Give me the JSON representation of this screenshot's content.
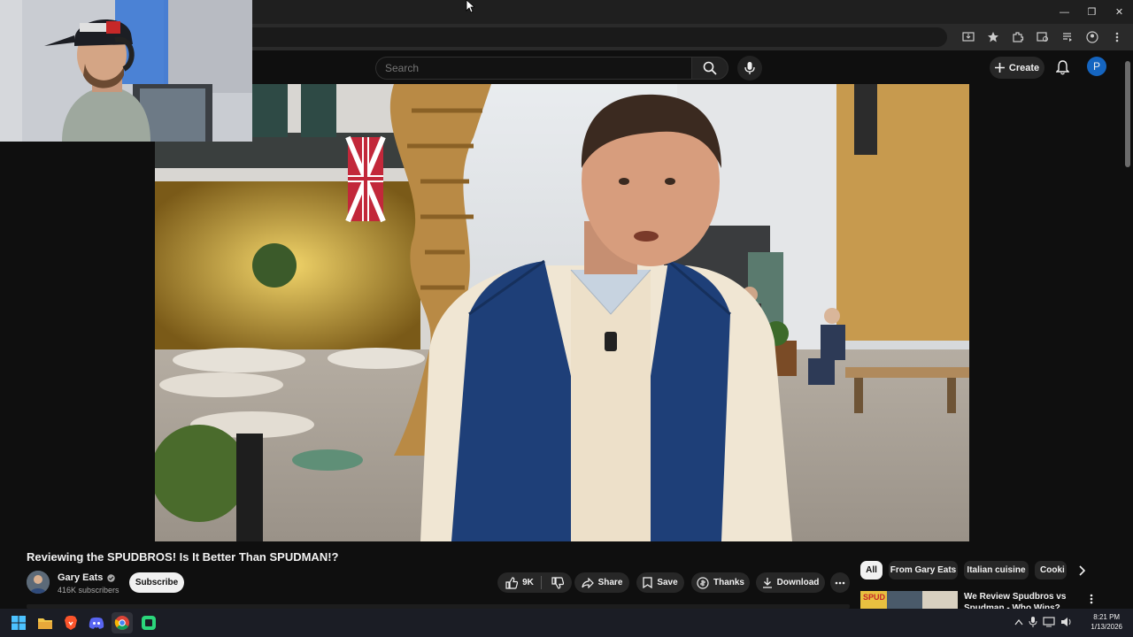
{
  "browser": {
    "window_controls": {
      "minimize": "—",
      "restore": "❐",
      "close": "✕"
    }
  },
  "header": {
    "search_placeholder": "Search",
    "create_label": "Create",
    "avatar_letter": "P"
  },
  "video": {
    "title": "Reviewing the SPUDBROS! Is It Better Than SPUDMAN!?"
  },
  "channel": {
    "name": "Gary Eats",
    "subscribers": "416K subscribers",
    "subscribe_label": "Subscribe"
  },
  "actions": {
    "likes": "9K",
    "share_label": "Share",
    "save_label": "Save",
    "thanks_label": "Thanks",
    "download_label": "Download"
  },
  "chips": [
    "All",
    "From Gary Eats",
    "Italian cuisine",
    "Cooki"
  ],
  "recommendation": {
    "title": "We Review Spudbros vs Spudman - Who Wins?",
    "thumb_text": "SPUD"
  },
  "taskbar": {
    "time": "8:21 PM",
    "date": "1/13/2026"
  },
  "colors": {
    "bg": "#0f0f0f",
    "pill": "#272727",
    "avatar": "#1565c0",
    "taskbar": "#1b1d25"
  }
}
